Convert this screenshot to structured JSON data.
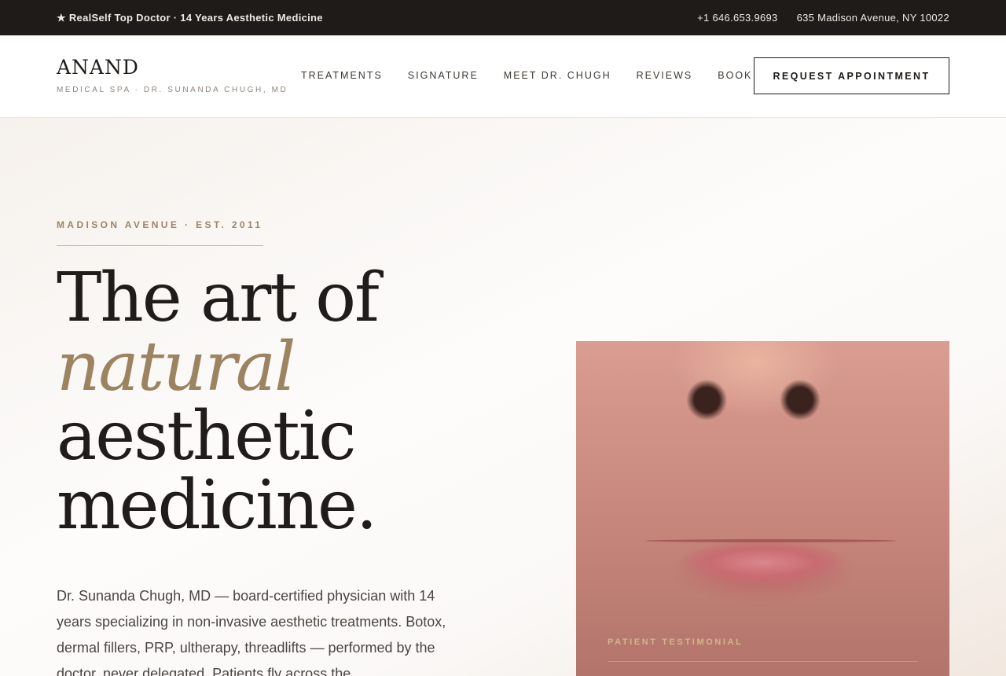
{
  "topbar": {
    "tagline": "★ RealSelf Top Doctor · 14 Years Aesthetic Medicine",
    "phone": "+1 646.653.9693",
    "address": "635 Madison Avenue, NY 10022"
  },
  "brand": {
    "name": "ANAND",
    "subtitle": "MEDICAL SPA · DR. SUNANDA CHUGH, MD"
  },
  "nav": {
    "links": [
      "TREATMENTS",
      "SIGNATURE",
      "MEET DR. CHUGH",
      "REVIEWS",
      "BOOK"
    ],
    "cta": "REQUEST APPOINTMENT"
  },
  "hero": {
    "eyebrow": "MADISON AVENUE · EST. 2011",
    "headline": {
      "line1": "The art of",
      "accent": "natural",
      "line3": "aesthetic",
      "line4": "medicine."
    },
    "lead": "Dr. Sunanda Chugh, MD — board-certified physician with 14 years specializing in non-invasive aesthetic treatments. Botox, dermal fillers, PRP, ultherapy, threadlifts — performed by the doctor, never delegated. Patients fly across the",
    "photo_caption": "PATIENT TESTIMONIAL"
  },
  "colors": {
    "accent": "#9c8460",
    "dark": "#1e1b18"
  }
}
